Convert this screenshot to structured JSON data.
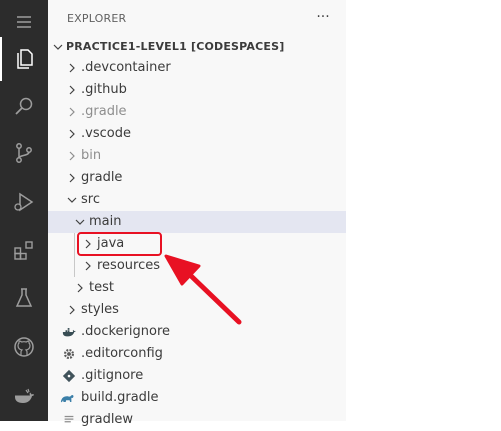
{
  "explorer": {
    "title": "EXPLORER",
    "more_actions": "···",
    "workspace": "PRACTICE1-LEVEL1 [CODESPACES]"
  },
  "tree": {
    "devcontainer": ".devcontainer",
    "github": ".github",
    "gradle_dir": ".gradle",
    "vscode": ".vscode",
    "bin": "bin",
    "gradle": "gradle",
    "src": "src",
    "main": "main",
    "java": "java",
    "resources": "resources",
    "test": "test",
    "styles": "styles",
    "dockerignore": ".dockerignore",
    "editorconfig": ".editorconfig",
    "gitignore": ".gitignore",
    "build_gradle": "build.gradle",
    "gradlew": "gradlew"
  },
  "activity_bar": {
    "icons": [
      "menu-icon",
      "explorer-icon",
      "search-icon",
      "source-control-icon",
      "run-debug-icon",
      "extensions-icon",
      "testing-icon",
      "github-icon",
      "docker-icon"
    ]
  },
  "colors": {
    "highlight": "#e81123",
    "selected_row": "#e4e6f1"
  }
}
